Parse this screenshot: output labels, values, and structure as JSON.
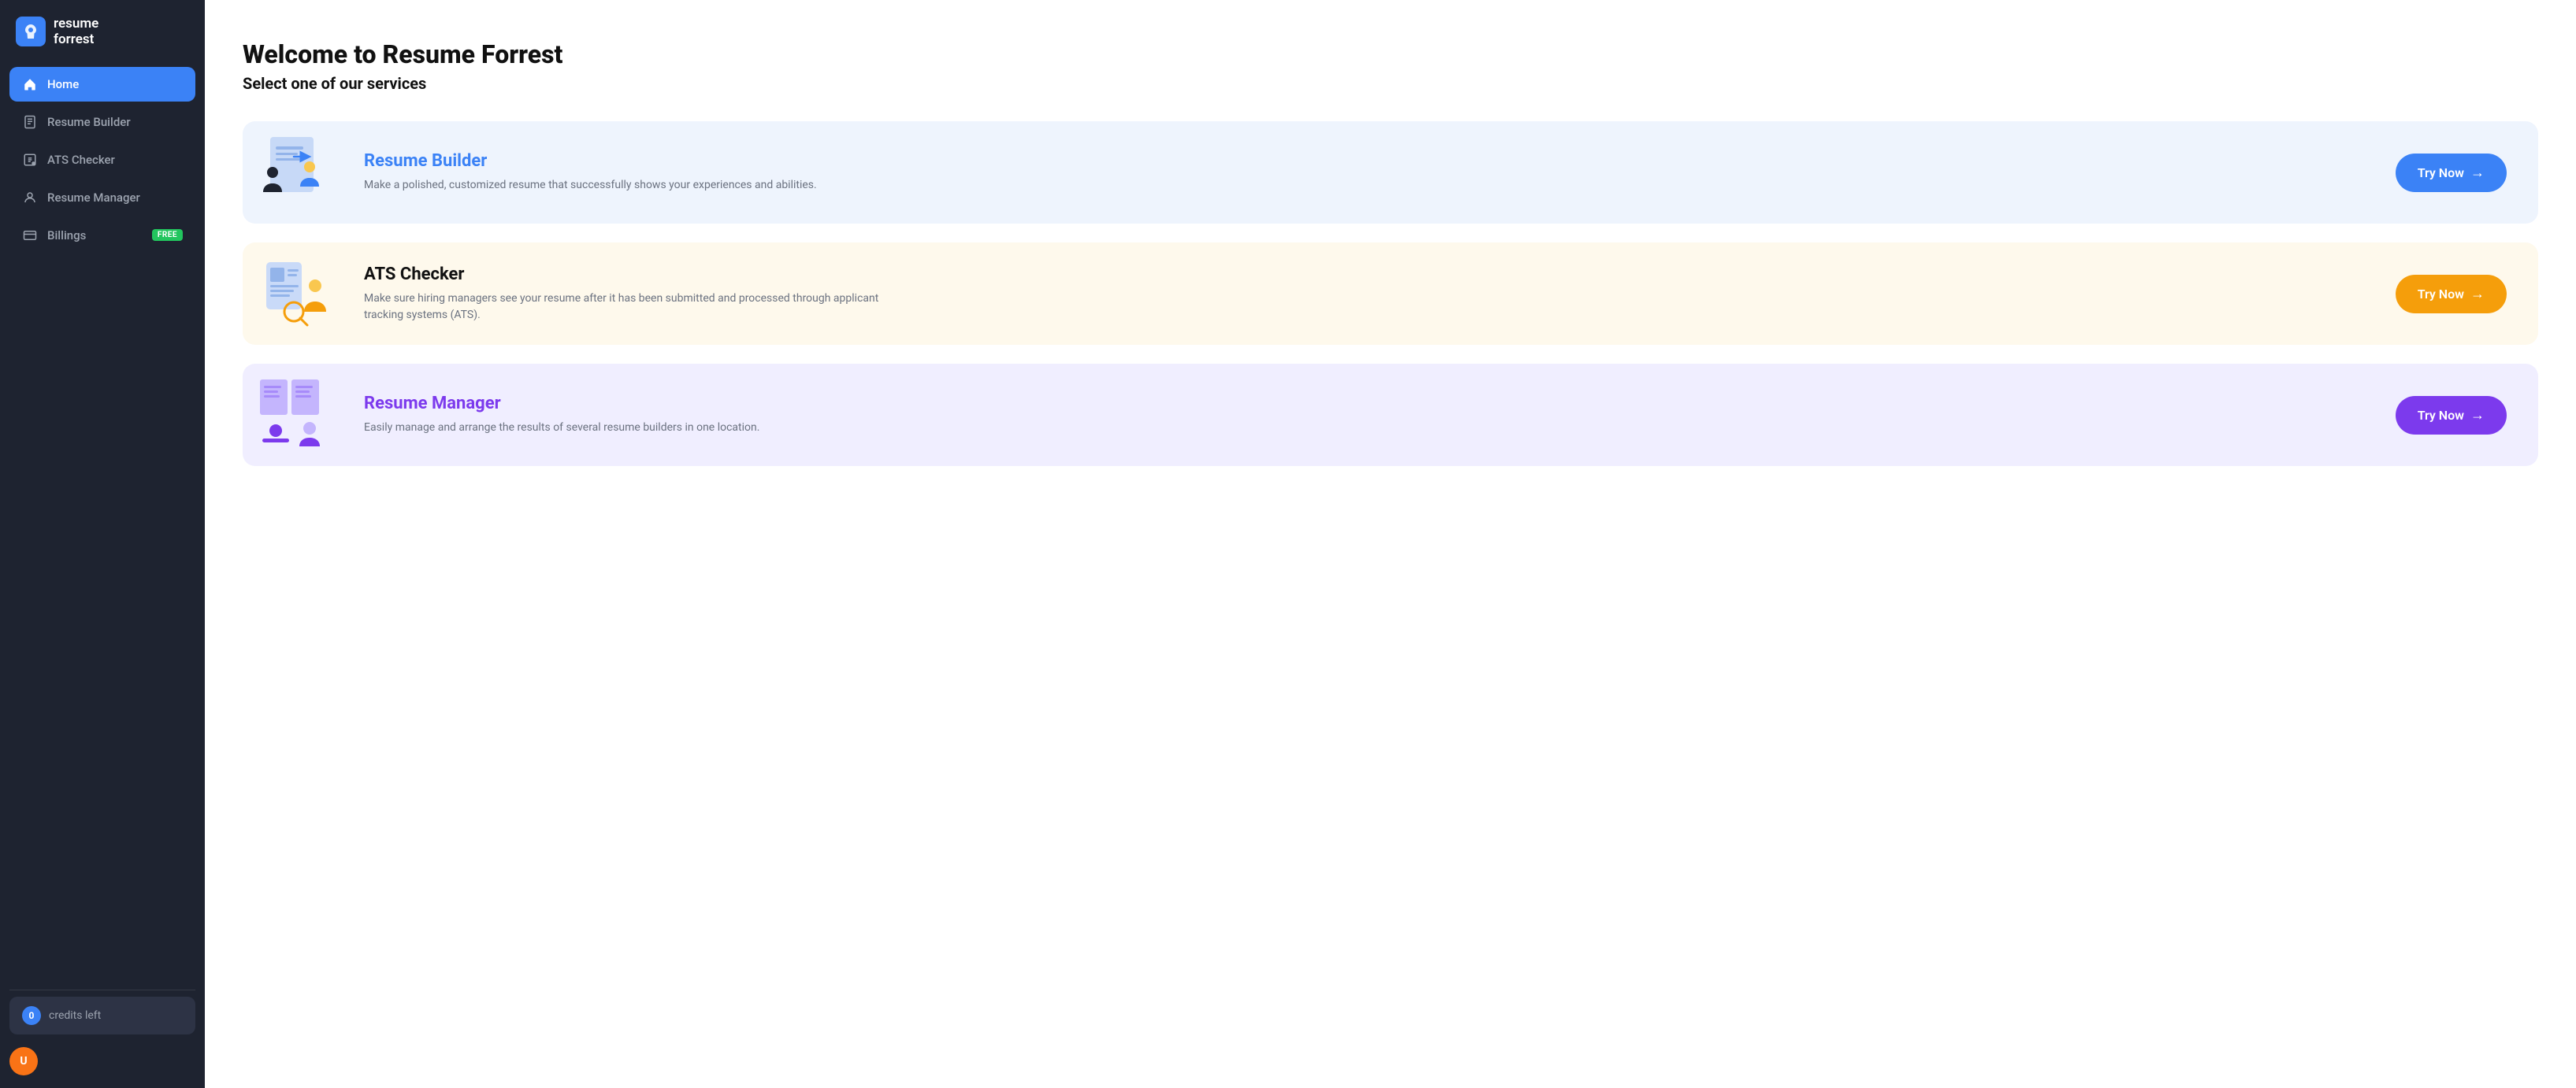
{
  "logo": {
    "icon": "🌿",
    "line1": "resume",
    "line2": "forrest"
  },
  "nav": {
    "items": [
      {
        "id": "home",
        "label": "Home",
        "active": true,
        "badge": null
      },
      {
        "id": "resume-builder",
        "label": "Resume Builder",
        "active": false,
        "badge": null
      },
      {
        "id": "ats-checker",
        "label": "ATS Checker",
        "active": false,
        "badge": null
      },
      {
        "id": "resume-manager",
        "label": "Resume Manager",
        "active": false,
        "badge": null
      },
      {
        "id": "billings",
        "label": "Billings",
        "active": false,
        "badge": "FREE"
      }
    ]
  },
  "credits": {
    "count": "0",
    "label": "credits left"
  },
  "page": {
    "title": "Welcome to Resume Forrest",
    "subtitle": "Select one of our services"
  },
  "services": [
    {
      "id": "resume-builder",
      "title": "Resume Builder",
      "titleColor": "blue",
      "cardColor": "blue",
      "description": "Make a polished, customized resume that successfully shows your experiences and abilities.",
      "buttonLabel": "Try Now",
      "buttonColor": "blue"
    },
    {
      "id": "ats-checker",
      "title": "ATS Checker",
      "titleColor": "dark",
      "cardColor": "yellow",
      "description": "Make sure hiring managers see your resume after it has been submitted and processed through applicant tracking systems (ATS).",
      "buttonLabel": "Try Now",
      "buttonColor": "yellow"
    },
    {
      "id": "resume-manager",
      "title": "Resume Manager",
      "titleColor": "purple",
      "cardColor": "purple",
      "description": "Easily manage and arrange the results of several resume builders in one location.",
      "buttonLabel": "Try Now",
      "buttonColor": "purple"
    }
  ]
}
